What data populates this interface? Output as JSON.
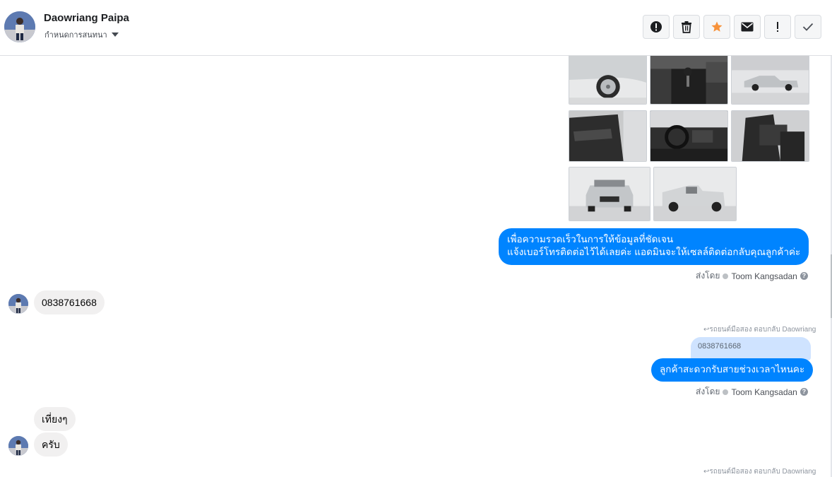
{
  "header": {
    "contact_name": "Daowriang Paipa",
    "assign_label": "กำหนดการสนทนา",
    "actions": [
      {
        "icon": "alert-circle-icon",
        "label": "Mark as spam"
      },
      {
        "icon": "trash-icon",
        "label": "Delete"
      },
      {
        "icon": "star-icon",
        "label": "Star",
        "color": "#f7923a"
      },
      {
        "icon": "envelope-icon",
        "label": "Mark as unread"
      },
      {
        "icon": "exclamation-icon",
        "label": "Follow up"
      },
      {
        "icon": "check-icon",
        "label": "Mark as done"
      }
    ]
  },
  "messages": {
    "out_info": {
      "line1": "เพื่อความรวดเร็วในการให้ข้อมูลที่ชัดเจน",
      "line2": "แจ้งเบอร์โทรติดต่อไว้ได้เลยค่ะ แอดมินจะให้เซลล์ติดต่อกลับคุณลูกค้าค่ะ"
    },
    "sent_by_1": {
      "prefix": "ส่งโดย",
      "agent": "Toom Kangsadan"
    },
    "in_phone": "0838761668",
    "reply_note": "รถยนต์มือสอง ตอบกลับ Daowriang",
    "quoted": "0838761668",
    "out_question": "ลูกค้าสะดวกรับสายช่วงเวลาไหนคะ",
    "sent_by_2": {
      "prefix": "ส่งโดย",
      "agent": "Toom Kangsadan"
    },
    "in_noon": "เที่ยงๆ",
    "in_krab": "ครับ"
  },
  "colors": {
    "outgoing_bubble": "#0084ff",
    "incoming_bubble": "#f1f0f0",
    "quote_bubble": "#cfe3ff"
  }
}
